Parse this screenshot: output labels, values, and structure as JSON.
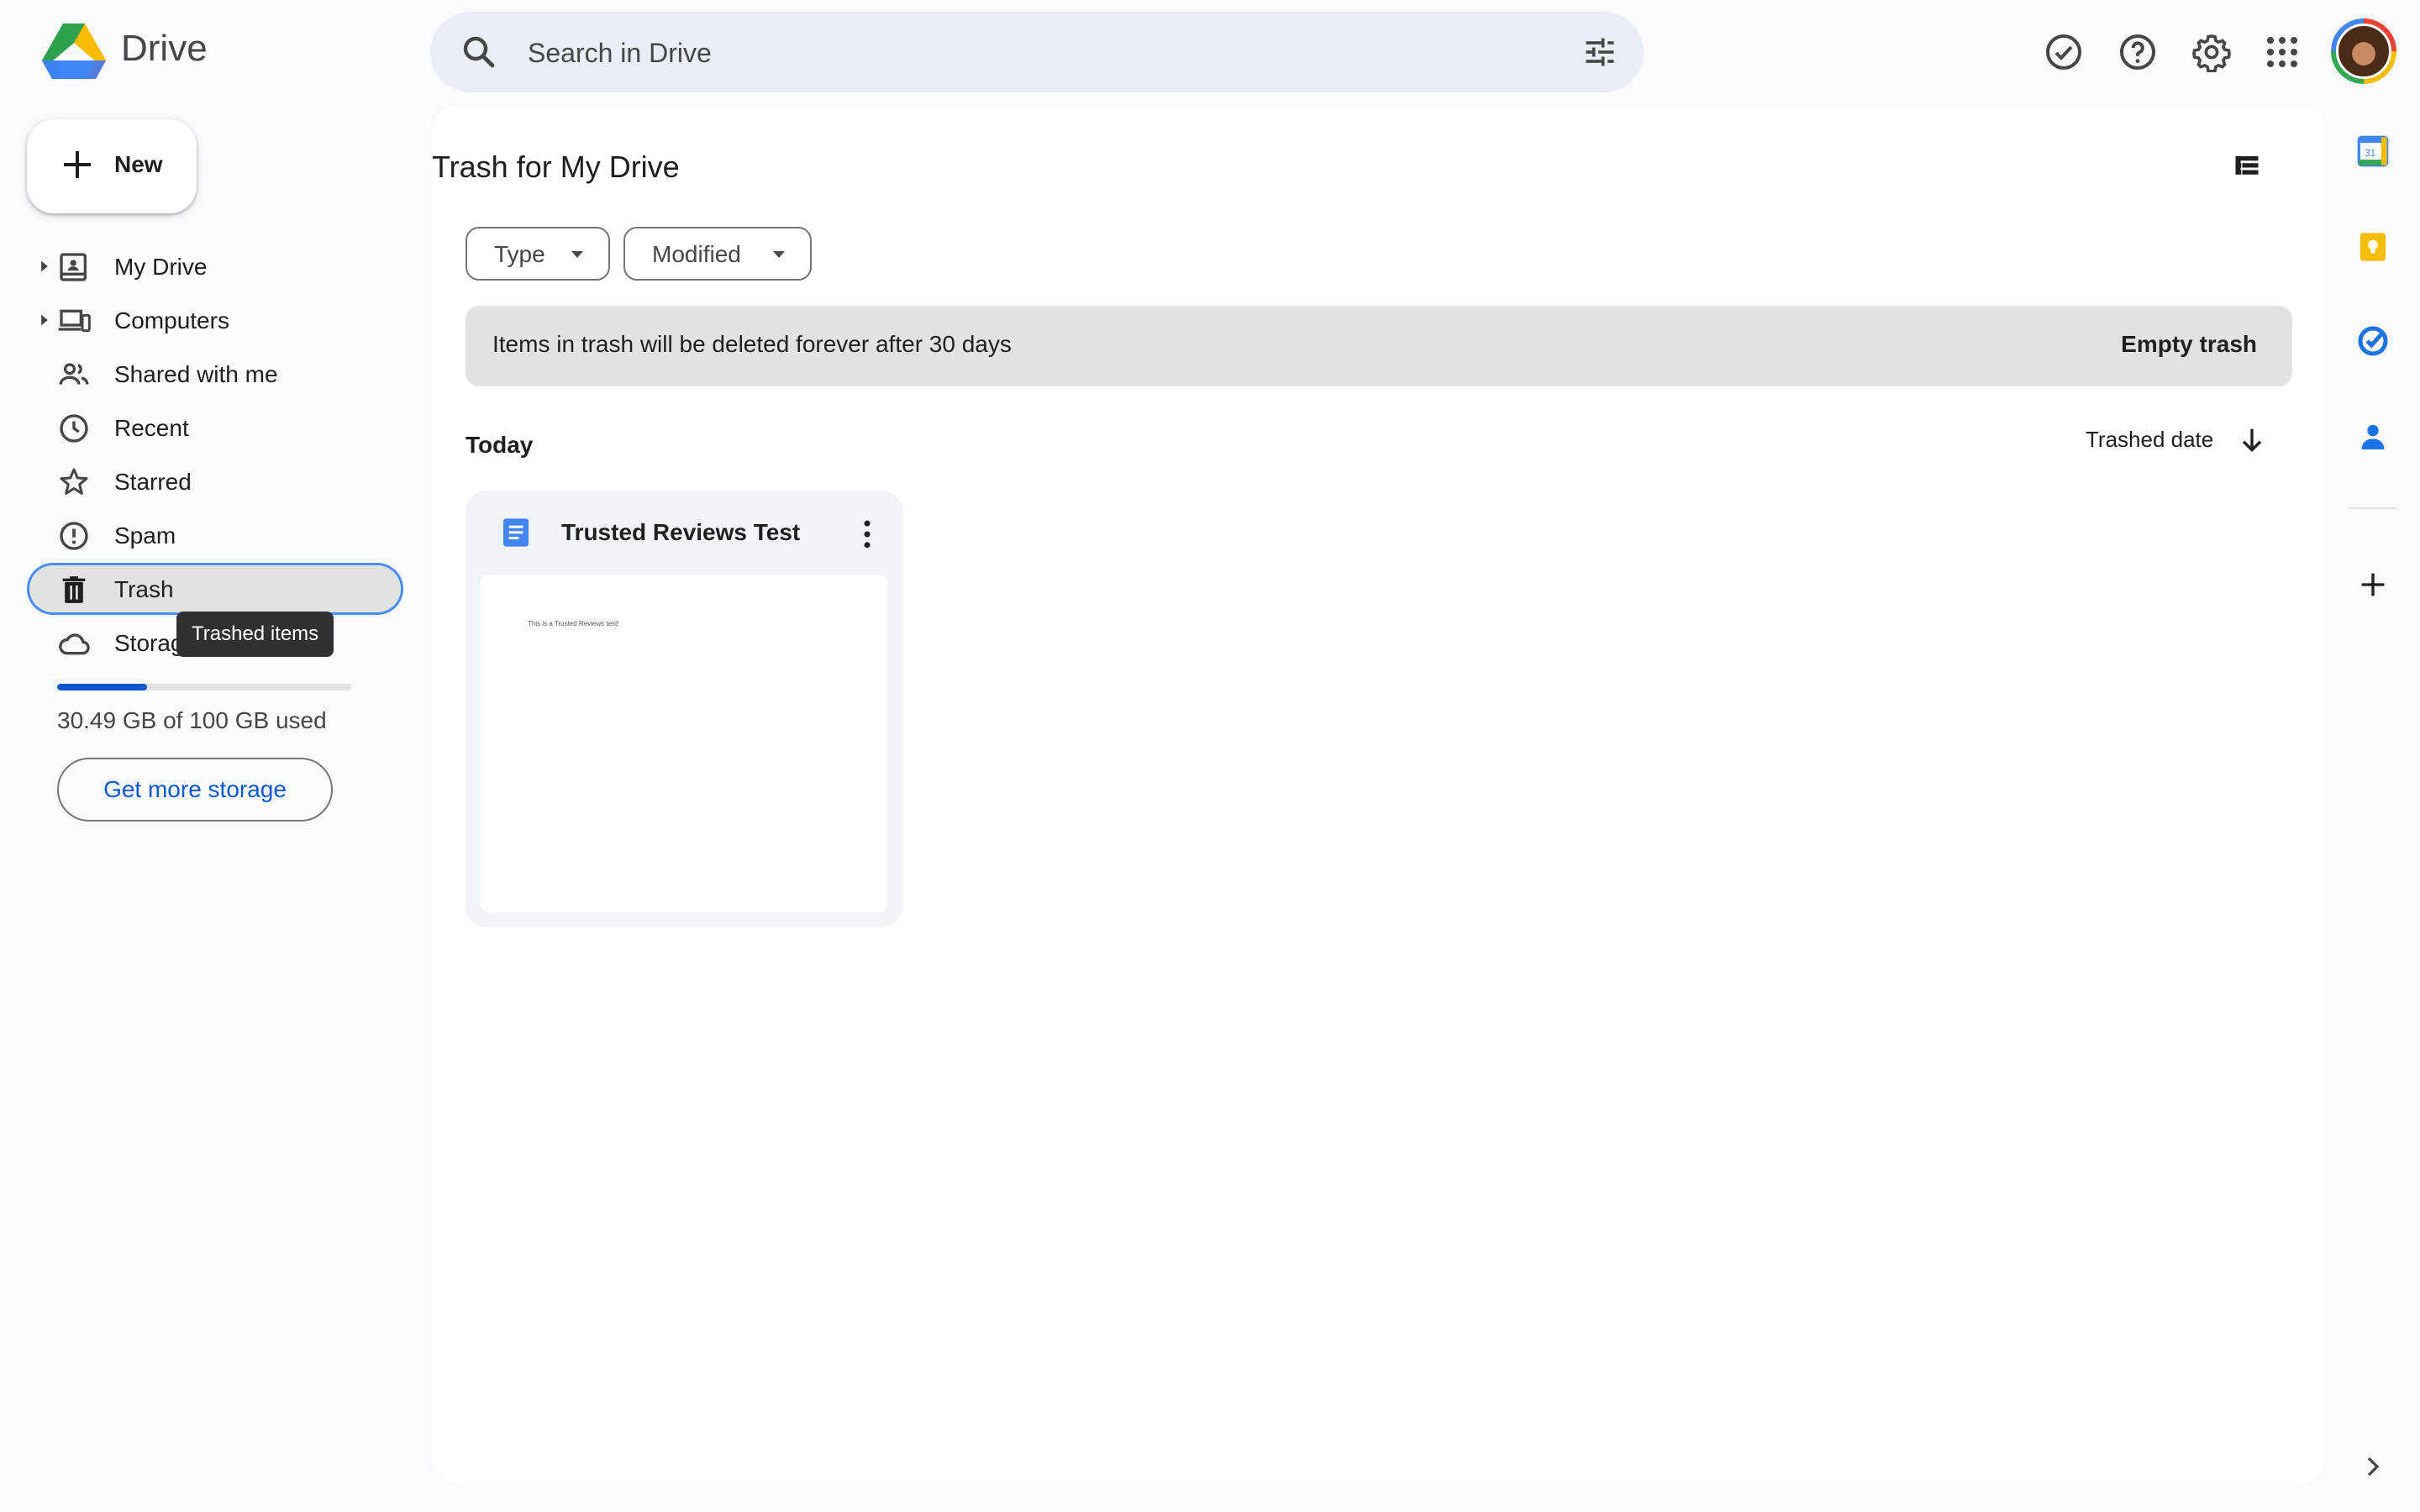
{
  "header": {
    "app_title": "Drive",
    "search": {
      "placeholder": "Search in Drive",
      "value": ""
    },
    "icons": [
      "ready-for-offline-icon",
      "help-icon",
      "settings-icon",
      "apps-icon",
      "account-avatar"
    ]
  },
  "sidebar": {
    "new_label": "New",
    "items": [
      {
        "label": "My Drive",
        "icon": "my-drive-icon",
        "expandable": true
      },
      {
        "label": "Computers",
        "icon": "computers-icon",
        "expandable": true
      },
      {
        "label": "Shared with me",
        "icon": "shared-icon"
      },
      {
        "label": "Recent",
        "icon": "clock-icon"
      },
      {
        "label": "Starred",
        "icon": "star-icon"
      },
      {
        "label": "Spam",
        "icon": "spam-icon"
      },
      {
        "label": "Trash",
        "icon": "trash-icon",
        "active": true
      },
      {
        "label": "Storage",
        "icon": "cloud-icon"
      }
    ],
    "tooltip": "Trashed items",
    "storage": {
      "used_text": "30.49 GB of 100 GB used",
      "fraction_used": 0.3049,
      "button_label": "Get more storage"
    }
  },
  "main": {
    "title": "Trash for My Drive",
    "filters": [
      {
        "label": "Type"
      },
      {
        "label": "Modified"
      }
    ],
    "banner": {
      "message": "Items in trash will be deleted forever after 30 days",
      "action": "Empty trash"
    },
    "group": {
      "label": "Today"
    },
    "sort": {
      "label": "Trashed date",
      "direction": "descending"
    },
    "files": [
      {
        "name": "Trusted Reviews Test",
        "type": "google-doc",
        "preview_text": "This is a Trusted Reviews test!"
      }
    ]
  },
  "colors": {
    "accent": "#0b57d0",
    "active_outline": "#4c8df6",
    "doc_blue": "#4285f4",
    "page_bg": "#f8fafd"
  }
}
